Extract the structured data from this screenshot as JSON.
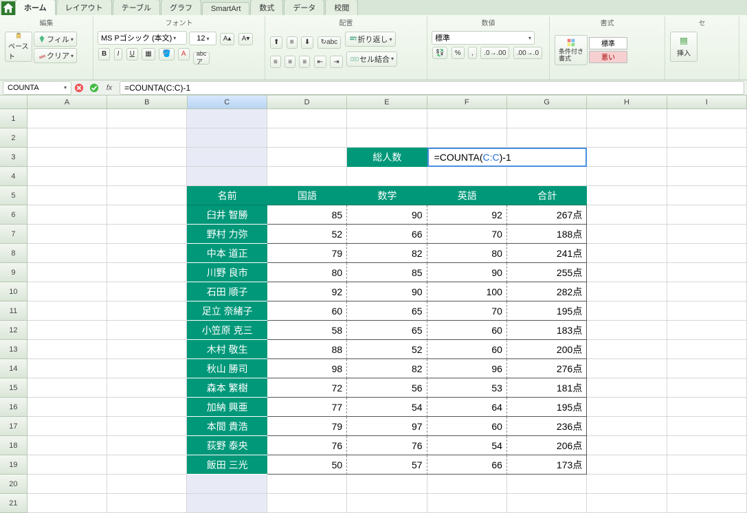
{
  "tabs": {
    "home": "ホーム",
    "layout": "レイアウト",
    "table": "テーブル",
    "chart": "グラフ",
    "smartart": "SmartArt",
    "formula": "数式",
    "data": "データ",
    "review": "校閲"
  },
  "ribbon_groups": {
    "edit": "編集",
    "font": "フォント",
    "align": "配置",
    "number": "数値",
    "format": "書式",
    "cells": "セ"
  },
  "ribbon": {
    "paste": "ペースト",
    "fill": "フィル",
    "clear": "クリア",
    "font_name": "MS Pゴシック (本文)",
    "font_size": "12",
    "wrap": "折り返し",
    "merge": "セル結合",
    "number_format": "標準",
    "conditional": "条件付き\n書式",
    "style1": "標準",
    "style2": "悪い",
    "insert": "挿入"
  },
  "formula_bar": {
    "name_box": "COUNTA",
    "formula": "=COUNTA(C:C)-1"
  },
  "columns": [
    "A",
    "B",
    "C",
    "D",
    "E",
    "F",
    "G",
    "H",
    "I"
  ],
  "active_col_index": 2,
  "row_numbers": [
    1,
    2,
    3,
    4,
    5,
    6,
    7,
    8,
    9,
    10,
    11,
    12,
    13,
    14,
    15,
    16,
    17,
    18,
    19,
    20,
    21
  ],
  "labels": {
    "total_people": "総人数",
    "editing_formula_prefix": "=COUNTA(",
    "editing_formula_ref": "C:C",
    "editing_formula_suffix": ")-1"
  },
  "table": {
    "headers": {
      "name": "名前",
      "jp": "国語",
      "math": "数学",
      "en": "英語",
      "total": "合計"
    },
    "rows": [
      {
        "name": "臼井 智勝",
        "jp": 85,
        "math": 90,
        "en": 92,
        "total": "267点"
      },
      {
        "name": "野村 力弥",
        "jp": 52,
        "math": 66,
        "en": 70,
        "total": "188点"
      },
      {
        "name": "中本 道正",
        "jp": 79,
        "math": 82,
        "en": 80,
        "total": "241点"
      },
      {
        "name": "川野 良市",
        "jp": 80,
        "math": 85,
        "en": 90,
        "total": "255点"
      },
      {
        "name": "石田 順子",
        "jp": 92,
        "math": 90,
        "en": 100,
        "total": "282点"
      },
      {
        "name": "足立 奈緒子",
        "jp": 60,
        "math": 65,
        "en": 70,
        "total": "195点"
      },
      {
        "name": "小笠原 克三",
        "jp": 58,
        "math": 65,
        "en": 60,
        "total": "183点"
      },
      {
        "name": "木村 敬生",
        "jp": 88,
        "math": 52,
        "en": 60,
        "total": "200点"
      },
      {
        "name": "秋山 勝司",
        "jp": 98,
        "math": 82,
        "en": 96,
        "total": "276点"
      },
      {
        "name": "森本 繁樹",
        "jp": 72,
        "math": 56,
        "en": 53,
        "total": "181点"
      },
      {
        "name": "加納 興亜",
        "jp": 77,
        "math": 54,
        "en": 64,
        "total": "195点"
      },
      {
        "name": "本間 貴浩",
        "jp": 79,
        "math": 97,
        "en": 60,
        "total": "236点"
      },
      {
        "name": "荻野 泰央",
        "jp": 76,
        "math": 76,
        "en": 54,
        "total": "206点"
      },
      {
        "name": "飯田 三光",
        "jp": 50,
        "math": 57,
        "en": 66,
        "total": "173点"
      }
    ]
  }
}
